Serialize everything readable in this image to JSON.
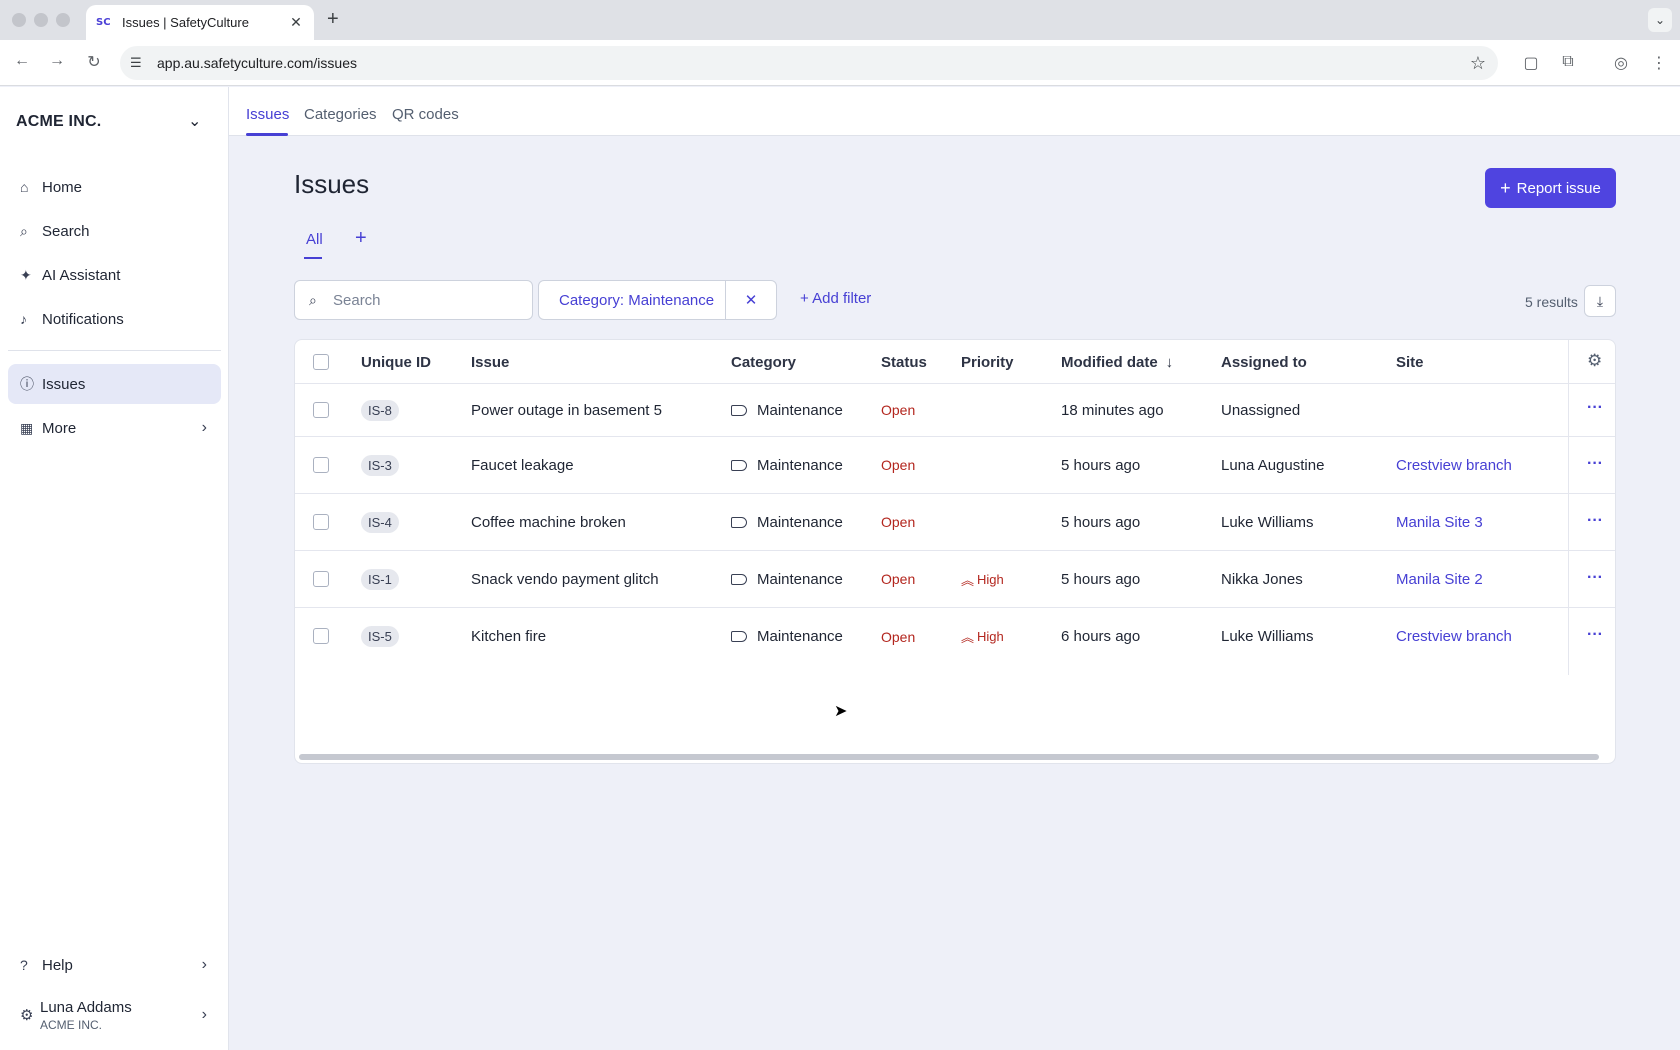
{
  "browser": {
    "tab_title": "Issues | SafetyCulture",
    "url": "app.au.safetyculture.com/issues",
    "favicon_text": "SC"
  },
  "sidebar": {
    "org_name": "ACME INC.",
    "items": [
      {
        "label": "Home",
        "icon": "home-icon"
      },
      {
        "label": "Search",
        "icon": "search-icon"
      },
      {
        "label": "AI Assistant",
        "icon": "sparkle-icon"
      },
      {
        "label": "Notifications",
        "icon": "bell-icon"
      },
      {
        "label": "Issues",
        "icon": "issue-icon",
        "active": true
      },
      {
        "label": "More",
        "icon": "grid-icon"
      }
    ],
    "help_label": "Help",
    "user": {
      "name": "Luna Addams",
      "org": "ACME INC."
    }
  },
  "topnav": {
    "tabs": [
      {
        "label": "Issues",
        "active": true
      },
      {
        "label": "Categories"
      },
      {
        "label": "QR codes"
      }
    ]
  },
  "page": {
    "title": "Issues",
    "report_button": "Report issue",
    "view_tab": "All",
    "view_add": "+"
  },
  "filters": {
    "search_placeholder": "Search",
    "chip_label": "Category: Maintenance",
    "add_filter": "Add filter",
    "results": "5 results"
  },
  "table": {
    "columns": [
      "Unique ID",
      "Issue",
      "Category",
      "Status",
      "Priority",
      "Modified date",
      "Assigned to",
      "Site"
    ],
    "rows": [
      {
        "id": "IS-8",
        "issue": "Power outage in basement 5",
        "category": "Maintenance",
        "status": "Open",
        "priority": "",
        "modified": "18 minutes ago",
        "assigned": "Unassigned",
        "site": ""
      },
      {
        "id": "IS-3",
        "issue": "Faucet leakage",
        "category": "Maintenance",
        "status": "Open",
        "priority": "",
        "modified": "5 hours ago",
        "assigned": "Luna Augustine",
        "site": "Crestview branch"
      },
      {
        "id": "IS-4",
        "issue": "Coffee machine broken",
        "category": "Maintenance",
        "status": "Open",
        "priority": "",
        "modified": "5 hours ago",
        "assigned": "Luke Williams",
        "site": "Manila Site 3"
      },
      {
        "id": "IS-1",
        "issue": "Snack vendo payment glitch",
        "category": "Maintenance",
        "status": "Open",
        "priority": "High",
        "modified": "5 hours ago",
        "assigned": "Nikka Jones",
        "site": "Manila Site 2"
      },
      {
        "id": "IS-5",
        "issue": "Kitchen fire",
        "category": "Maintenance",
        "status": "Open",
        "priority": "High",
        "modified": "6 hours ago",
        "assigned": "Luke Williams",
        "site": "Crestview branch"
      }
    ]
  },
  "colors": {
    "accent": "#4f44e0",
    "status_open": "#b3261e",
    "sidebar_active": "#e5e8f7"
  }
}
